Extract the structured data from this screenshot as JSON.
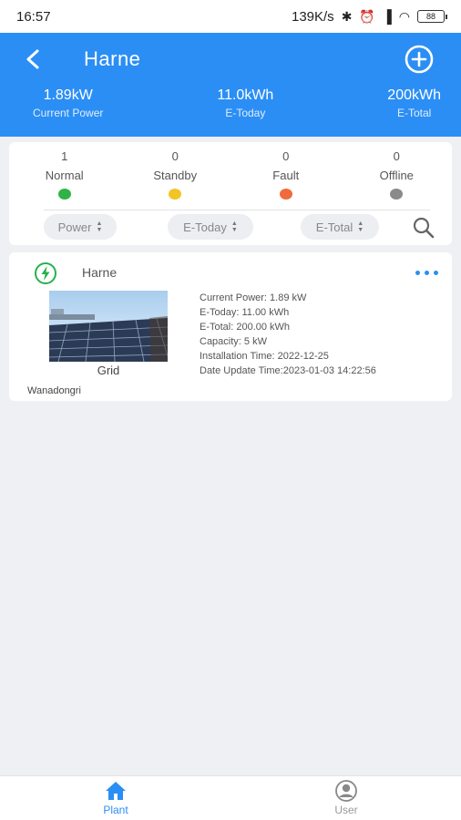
{
  "statusbar": {
    "time": "16:57",
    "speed": "139K/s",
    "battery": "88"
  },
  "header": {
    "title": "Harne",
    "stats": [
      {
        "value": "1.89kW",
        "label": "Current Power"
      },
      {
        "value": "11.0kWh",
        "label": "E-Today"
      },
      {
        "value": "200kWh",
        "label": "E-Total"
      }
    ]
  },
  "status": [
    {
      "count": "1",
      "label": "Normal",
      "color": "#2fb344"
    },
    {
      "count": "0",
      "label": "Standby",
      "color": "#f3c425"
    },
    {
      "count": "0",
      "label": "Fault",
      "color": "#f16a3b"
    },
    {
      "count": "0",
      "label": "Offline",
      "color": "#8a8a8a"
    }
  ],
  "sort": {
    "power": "Power",
    "etoday": "E-Today",
    "etotal": "E-Total"
  },
  "plant": {
    "name": "Harne",
    "type": "Grid",
    "current_power": "Current Power: 1.89 kW",
    "e_today": "E-Today: 11.00 kWh",
    "e_total": "E-Total: 200.00 kWh",
    "capacity": "Capacity: 5 kW",
    "installation_time": "Installation Time: 2022-12-25",
    "update_time": "Date Update Time:2023-01-03 14:22:56",
    "location": "Wanadongri"
  },
  "tabs": {
    "plant": "Plant",
    "user": "User",
    "active_color": "#2b8ef5",
    "inactive_color": "#999999"
  }
}
